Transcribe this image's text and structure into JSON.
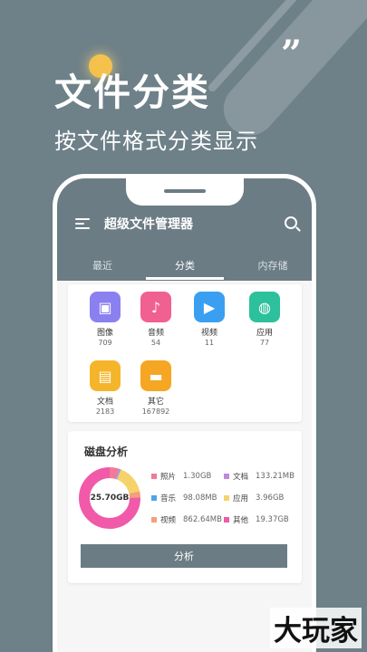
{
  "promo": {
    "headline": "文件分类",
    "subheadline": "按文件格式分类显示",
    "quote_mark": "”"
  },
  "app": {
    "title": "超级文件管理器"
  },
  "tabs": [
    {
      "label": "最近"
    },
    {
      "label": "分类"
    },
    {
      "label": "内存储"
    }
  ],
  "categories": [
    {
      "label": "图像",
      "count": "709",
      "icon": "image-icon",
      "color": "#8b80f0",
      "glyph": "▣"
    },
    {
      "label": "音频",
      "count": "54",
      "icon": "music-icon",
      "color": "#f06090",
      "glyph": "♪"
    },
    {
      "label": "视频",
      "count": "11",
      "icon": "video-icon",
      "color": "#3a9ff0",
      "glyph": "▶"
    },
    {
      "label": "应用",
      "count": "77",
      "icon": "android-icon",
      "color": "#2cc09c",
      "glyph": "◍"
    },
    {
      "label": "文档",
      "count": "2183",
      "icon": "document-icon",
      "color": "#f5b52a",
      "glyph": "▤"
    },
    {
      "label": "其它",
      "count": "167892",
      "icon": "folder-icon",
      "color": "#f5a623",
      "glyph": "▬"
    }
  ],
  "disk": {
    "title": "磁盘分析",
    "total": "25.70GB",
    "analyze_label": "分析",
    "legend": [
      {
        "label": "照片",
        "value": "1.30GB",
        "color": "#f07a9a",
        "amount": 1.3
      },
      {
        "label": "文档",
        "value": "133.21MB",
        "color": "#c08ad8",
        "amount": 0.13
      },
      {
        "label": "音乐",
        "value": "98.08MB",
        "color": "#4fa4e8",
        "amount": 0.1
      },
      {
        "label": "应用",
        "value": "3.96GB",
        "color": "#f5d36a",
        "amount": 3.96
      },
      {
        "label": "视频",
        "value": "862.64MB",
        "color": "#f4a07a",
        "amount": 0.86
      },
      {
        "label": "其他",
        "value": "19.37GB",
        "color": "#f05aa8",
        "amount": 19.37
      }
    ]
  },
  "watermark": "大玩家"
}
